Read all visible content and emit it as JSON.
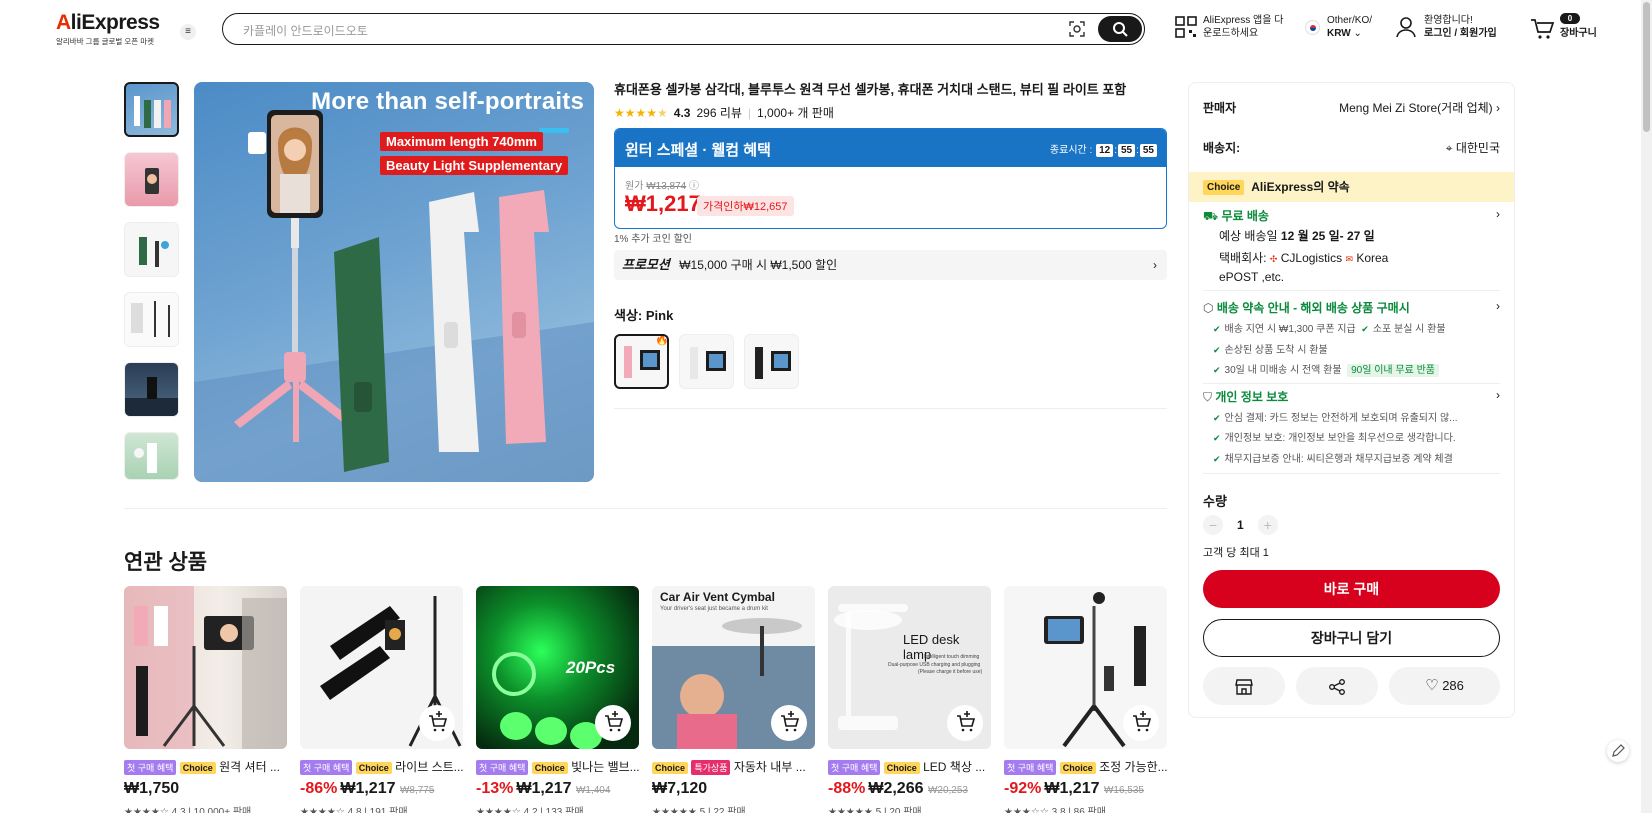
{
  "header": {
    "logo": "AliExpress",
    "logo_sub": "알리바바 그룹 글로벌 오픈 마켓",
    "search_placeholder": "카플레이 안드로이드오토",
    "app_line1": "AliExpress 앱을 다",
    "app_line2": "운로드하세요",
    "locale_line1": "Other/KO/",
    "locale_line2": "KRW",
    "user_line1": "환영합니다!",
    "user_line2": "로그인 / 회원가입",
    "cart_count": "0",
    "cart_label": "장바구니"
  },
  "gallery": {
    "headline": "More than self-portraits",
    "tag1": "Maximum length 740mm",
    "tag2": "Beauty Light Supplementary"
  },
  "product": {
    "title": "휴대폰용 셀카봉 삼각대, 블루투스 원격 무선 셀카봉, 휴대폰 거치대 스탠드, 뷰티 필 라이트 포함",
    "rating": "4.3",
    "reviews": "296 리뷰",
    "sold": "1,000+ 개 판매",
    "deal_title": "윈터 스페셜 · 웰컴 혜택",
    "timer_label": "종료시간 :",
    "timer_h": "12",
    "timer_m": "55",
    "timer_s": "55",
    "original_label": "원가",
    "original_price": "₩13,874",
    "price": "₩1,217",
    "discount": "가격인하₩12,657",
    "coin": "1% 추가 코인 할인",
    "promo_label": "프로모션",
    "promo_text": "₩15,000 구매 시 ₩1,500 할인",
    "color_label": "색상: Pink"
  },
  "panel": {
    "seller_label": "판매자",
    "seller_name": "Meng Mei Zi Store(거래 업체)",
    "ship_to_label": "배송지:",
    "ship_to": "대한민국",
    "choice_badge": "Choice",
    "choice_text": "AliExpress의 약속",
    "free_ship": "무료 배송",
    "eta_label": "예상 배송일",
    "eta": "12 월 25 일- 27 일",
    "carrier_label": "택배회사:",
    "carrier1": "CJLogistics",
    "carrier2": "Korea",
    "carrier3": "ePOST ,etc.",
    "promise_title": "배송 약속 안내 - 해외 배송 상품 구매시",
    "promise1": "배송 지연 시 ₩1,300 쿠폰 지급",
    "promise2": "소포 분실 시 환불",
    "promise3": "손상된 상품 도착 시 환불",
    "promise4": "30일 내 미배송 시 전액 환불",
    "promise4_pill": "90일 이내 무료 반품",
    "privacy_title": "개인 정보 보호",
    "privacy1": "안심 결제: 카드 정보는 안전하게 보호되며 유출되지 않...",
    "privacy2": "개인정보 보호: 개인정보 보안을 최우선으로 생각합니다.",
    "privacy3": "채무지급보증 안내: 씨티은행과 채무지급보증 계약 체결",
    "qty_label": "수량",
    "qty_minus": "−",
    "qty_value": "1",
    "qty_plus": "+",
    "qty_limit": "고객 당 최대 1",
    "buy_now": "바로 구매",
    "add_cart": "장바구니 담기",
    "wish_count": "286"
  },
  "related": {
    "title": "연관 상품",
    "items": [
      {
        "b1": "첫 구매 혜택",
        "b2": "Choice",
        "b3": "",
        "name": "원격 셔터 ...",
        "pct": "",
        "price": "₩1,750",
        "orig": "",
        "rating": "★★★★☆ 4.3 | 10,000+ 판매"
      },
      {
        "b1": "첫 구매 혜택",
        "b2": "Choice",
        "b3": "",
        "name": "라이브 스트...",
        "pct": "-86%",
        "price": "₩1,217",
        "orig": "₩8,775",
        "rating": "★★★★☆ 4.8 | 191 판매"
      },
      {
        "b1": "첫 구매 혜택",
        "b2": "Choice",
        "b3": "",
        "name": "빛나는 밸브...",
        "pct": "-13%",
        "price": "₩1,217",
        "orig": "₩1,404",
        "rating": "★★★★☆ 4.2 | 133 판매"
      },
      {
        "b1": "",
        "b2": "Choice",
        "b3": "특가상품",
        "name": "자동차 내부 ...",
        "pct": "",
        "price": "₩7,120",
        "orig": "",
        "rating": "★★★★★ 5 | 22 판매"
      },
      {
        "b1": "첫 구매 혜택",
        "b2": "Choice",
        "b3": "",
        "name": "LED 책상 ...",
        "pct": "-88%",
        "price": "₩2,266",
        "orig": "₩20,253",
        "rating": "★★★★★ 5 | 20 판매"
      },
      {
        "b1": "첫 구매 혜택",
        "b2": "Choice",
        "b3": "",
        "name": "조정 가능한...",
        "pct": "-92%",
        "price": "₩1,217",
        "orig": "₩16,535",
        "rating": "★★★☆☆ 3.8 | 86 판매"
      }
    ],
    "img3_text": "20Pcs",
    "img4_text": "Car Air Vent Cymbal",
    "img4_sub": "Your driver's seat just became a drum kit",
    "img5_text": "LED desk lamp",
    "img5_sub1": "Intelligent touch dimming",
    "img5_sub2": "Dual-purpose USB charging and plugging",
    "img5_sub3": "(Please charge it before use)"
  },
  "colors": {
    "brand_red": "#e62e04",
    "deal_blue": "#1a74c6",
    "buy_red": "#d7001d",
    "choice_yellow": "#ffd55a",
    "green": "#0a8a3a"
  }
}
